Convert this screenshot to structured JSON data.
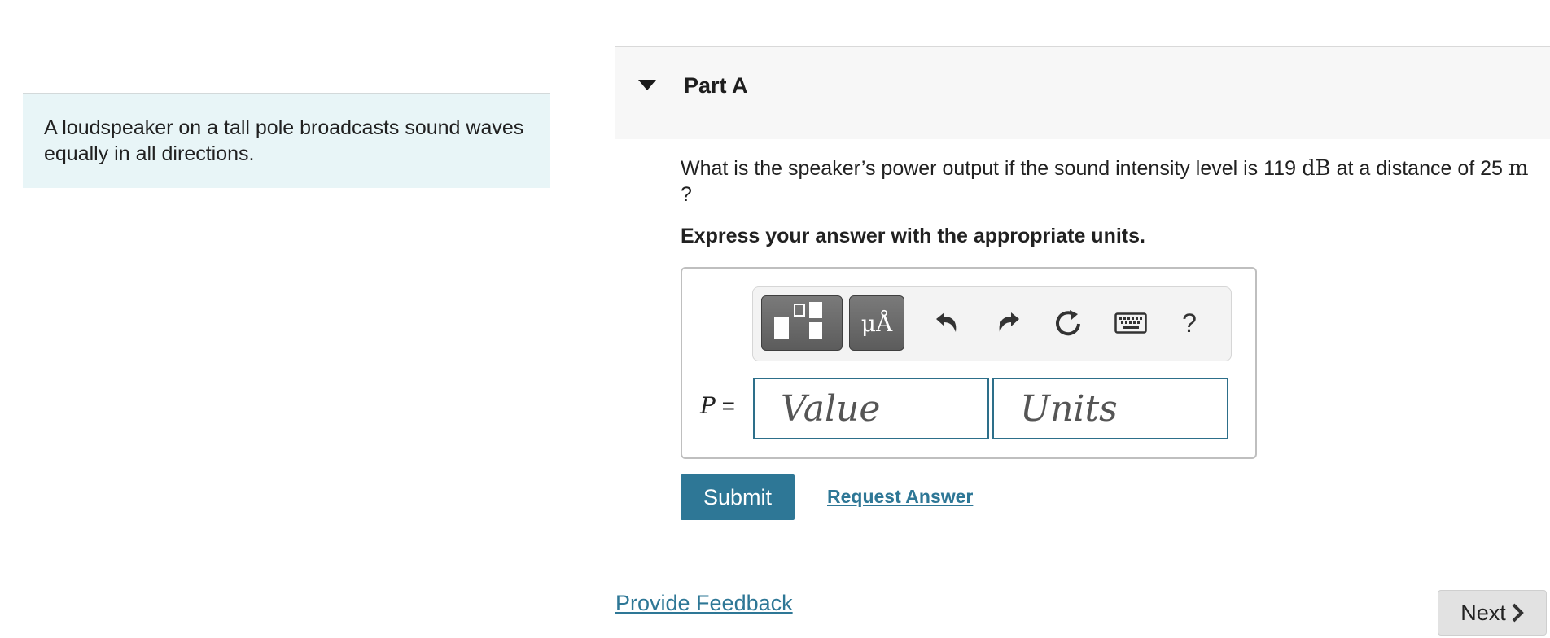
{
  "intro": {
    "text": "A loudspeaker on a tall pole broadcasts sound waves equally in all directions."
  },
  "part": {
    "title": "Part A"
  },
  "question": {
    "text_before": "What is the speaker’s power output if the sound intensity level is 119 ",
    "unit_db": "dB",
    "text_middle": " at a distance of ",
    "distance_value": "25",
    "unit_m": "m",
    "text_after": " ?"
  },
  "instruction": "Express your answer with the appropriate units.",
  "toolbar": {
    "units_label": "μÅ",
    "help_label": "?",
    "icons": [
      "templates-icon",
      "units-icon",
      "undo-icon",
      "redo-icon",
      "reset-icon",
      "keyboard-icon",
      "help-icon"
    ]
  },
  "answer": {
    "variable": "P",
    "equals": " =",
    "value_placeholder": "Value",
    "units_placeholder": "Units"
  },
  "buttons": {
    "submit": "Submit",
    "request_answer": "Request Answer",
    "provide_feedback": "Provide Feedback",
    "next": "Next"
  },
  "colors": {
    "accent": "#2e7796",
    "intro_background": "#e8f5f7",
    "header_background": "#f7f7f7"
  }
}
